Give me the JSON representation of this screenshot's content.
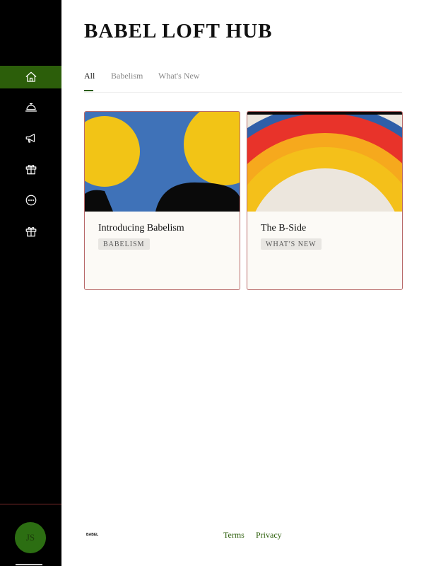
{
  "sidebar": {
    "items": [
      {
        "icon": "home-icon",
        "active": true
      },
      {
        "icon": "service-bell-icon",
        "active": false
      },
      {
        "icon": "megaphone-icon",
        "active": false
      },
      {
        "icon": "gift-icon",
        "active": false
      },
      {
        "icon": "chat-bubble-icon",
        "active": false
      },
      {
        "icon": "gift-icon",
        "active": false
      }
    ],
    "avatar_initials": "JS",
    "active_color": "#2c5e0a"
  },
  "header": {
    "title": "BABEL LOFT HUB"
  },
  "tabs": [
    {
      "label": "All",
      "active": true
    },
    {
      "label": "Babelism",
      "active": false
    },
    {
      "label": "What's New",
      "active": false
    }
  ],
  "cards": [
    {
      "title": "Introducing Babelism",
      "badge": "BABELISM"
    },
    {
      "title": "The B-Side",
      "badge": "WHAT'S NEW"
    }
  ],
  "footer": {
    "logo_text": "BABEL",
    "links": [
      "Terms",
      "Privacy"
    ]
  }
}
